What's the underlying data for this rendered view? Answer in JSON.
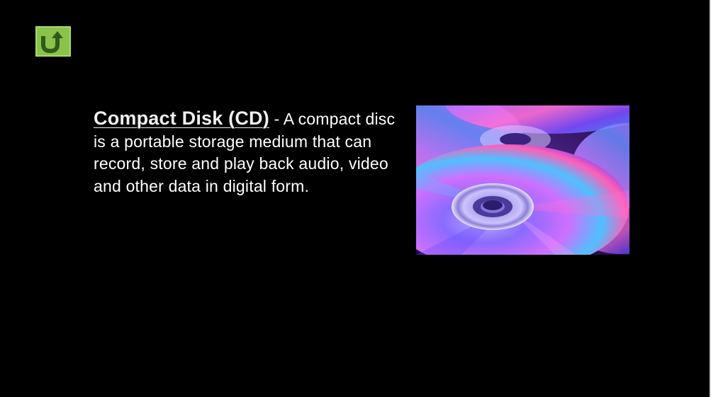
{
  "slide": {
    "background": "#000000",
    "nav": {
      "back_icon": "u-turn-arrow-icon",
      "back_color": "#8bc34a"
    },
    "definition": {
      "term": "Compact Disk (CD)",
      "separator": " - ",
      "body": "A compact disc is a portable storage medium that can record, store and play back audio, video and other data in digital form."
    },
    "photo": {
      "subject": "compact-discs-photo"
    }
  }
}
